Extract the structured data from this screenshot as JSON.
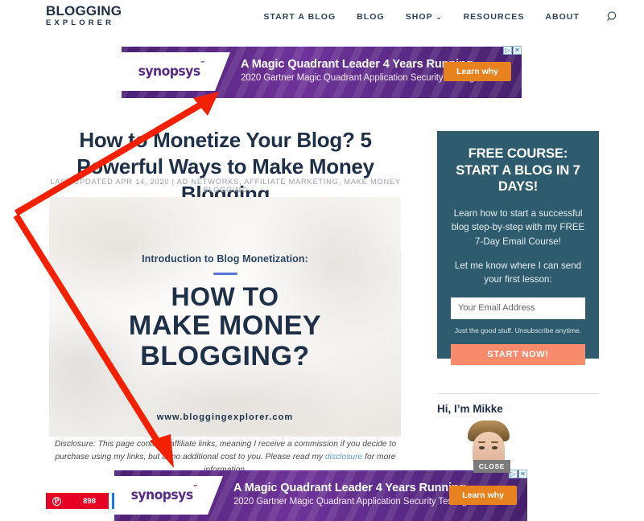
{
  "header": {
    "logo": {
      "line1": "BLOGGING",
      "line2": "EXPLORER"
    },
    "nav": [
      {
        "label": "START A BLOG",
        "has_dropdown": false
      },
      {
        "label": "BLOG",
        "has_dropdown": false
      },
      {
        "label": "SHOP",
        "has_dropdown": true,
        "chevron": "⌄"
      },
      {
        "label": "RESOURCES",
        "has_dropdown": false
      },
      {
        "label": "ABOUT",
        "has_dropdown": false
      }
    ],
    "search_icon": "search-icon"
  },
  "ad_top": {
    "advertiser": "synopsys",
    "trademark": "™",
    "headline": "A Magic Quadrant Leader 4 Years Running",
    "subline": "2020 Gartner Magic Quadrant Application Security Testing",
    "cta": "Learn why",
    "adchoices_play": "▷",
    "adchoices_close": "✕",
    "bg_color": "#5b2b82",
    "cta_color": "#e8821e"
  },
  "ad_bottom": {
    "advertiser": "synopsys",
    "trademark": "™",
    "headline": "A Magic Quadrant Leader 4 Years Running",
    "subline": "2020 Gartner Magic Quadrant Application Security Testing",
    "cta": "Learn why",
    "adchoices_play": "▷",
    "adchoices_close": "✕",
    "close_label": "CLOSE"
  },
  "article": {
    "title": "How to Monetize Your Blog? 5 Powerful Ways to Make Money Blogging",
    "meta": "LAST UPDATED APR 14, 2020  |  AD NETWORKS, AFFILIATE MARKETING, MAKE MONEY BLOGGING",
    "featured_image": {
      "kicker": "Introduction to Blog Monetization:",
      "line1": "HOW TO",
      "line2": "MAKE MONEY",
      "line3": "BLOGGING?",
      "url": "www.bloggingexplorer.com"
    },
    "disclosure": {
      "part1": "Disclosure: This page contains affiliate links, meaning I receive a commission if you decide to purchase using my links, but at no additional cost to you. Please read my ",
      "link": "disclosure",
      "part2": " for more information."
    }
  },
  "share": {
    "pinterest_label": "pinterest-icon",
    "pinterest_glyph": "P",
    "pinterest_count": "898",
    "pinterest_color": "#e60023",
    "facebook_color": "#1877f2"
  },
  "sidebar": {
    "optin": {
      "title": "FREE COURSE: START A BLOG IN 7 DAYS!",
      "paragraph1": "Learn how to start a successful blog step-by-step with my FREE 7-Day Email Course!",
      "paragraph2": "Let me know where I can send your first lesson:",
      "email_placeholder": "Your Email Address",
      "email_value": "",
      "note": "Just the good stuff. Unsubscribe anytime.",
      "button": "START NOW!",
      "bg_color": "#2e5c6e",
      "button_color": "#f98b6d"
    },
    "about": {
      "title": "Hi, I’m Mikke",
      "avatar": "author-photo"
    }
  },
  "annotations": {
    "arrow_color": "#f52000",
    "arrow1_target": "top-ad-banner",
    "arrow2_target": "bottom-ad-banner"
  }
}
